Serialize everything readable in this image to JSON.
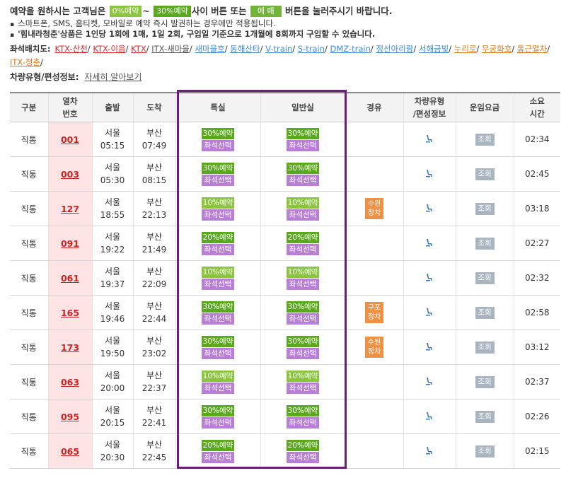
{
  "notice": {
    "line1_a": "예약을 원하시는 고객님은",
    "pill_0": "0%예약",
    "tilde": "~",
    "pill_30": "30%예약",
    "line1_b": "사이 버튼 또는",
    "pill_buy": "예 매",
    "line1_c": "버튼을 눌러주시기 바랍니다.",
    "bullet1": "스마트폰, SMS, 홈티켓, 모바일로 예약 즉시 발권하는 경우에만 적용됩니다.",
    "bullet2": "'힘내라청춘'상품은 1인당 1회에 1매, 1일 2회, 구입일 기준으로 1개월에 8회까지 구입할 수 있습니다."
  },
  "seatmap": {
    "label": "좌석배치도:",
    "links": [
      {
        "text": "KTX-산천",
        "color": "#d9262f"
      },
      {
        "text": "KTX-이음",
        "color": "#d9262f"
      },
      {
        "text": "KTX",
        "color": "#d9262f"
      },
      {
        "text": "ITX-새마을",
        "color": "#555555"
      },
      {
        "text": "새마을호",
        "color": "#3d8bd9"
      },
      {
        "text": "동해산타",
        "color": "#3d8bd9"
      },
      {
        "text": "V-train",
        "color": "#3d8bd9"
      },
      {
        "text": "S-train",
        "color": "#3d8bd9"
      },
      {
        "text": "DMZ-train",
        "color": "#3d8bd9"
      },
      {
        "text": "정선아리랑",
        "color": "#3d8bd9"
      },
      {
        "text": "서해금빛",
        "color": "#3d8bd9"
      },
      {
        "text": "누리로",
        "color": "#e07b1a"
      },
      {
        "text": "무궁화호",
        "color": "#e07b1a"
      },
      {
        "text": "통근열차",
        "color": "#e07b1a"
      },
      {
        "text": "ITX-청춘",
        "color": "#e07b1a"
      }
    ]
  },
  "cartype": {
    "label": "차량유형/편성정보:",
    "link": "자세히 알아보기"
  },
  "headers": {
    "type": "구분",
    "trainno_a": "열차",
    "trainno_b": "번호",
    "dep": "출발",
    "arr": "도착",
    "special": "특실",
    "general": "일반실",
    "via": "경유",
    "car_a": "차량유형",
    "car_b": "/편성정보",
    "fare": "운임요금",
    "dur_a": "소요",
    "dur_b": "시간"
  },
  "rows": [
    {
      "type": "직통",
      "no": "001",
      "dep": "서울",
      "dep_time": "05:15",
      "arr": "부산",
      "arr_time": "07:49",
      "special": "30%예약",
      "general": "30%예약",
      "seat": "좌석선택",
      "via": "",
      "fare": "조회",
      "dur": "02:34"
    },
    {
      "type": "직통",
      "no": "003",
      "dep": "서울",
      "dep_time": "05:30",
      "arr": "부산",
      "arr_time": "08:15",
      "special": "30%예약",
      "general": "30%예약",
      "seat": "좌석선택",
      "via": "",
      "fare": "조회",
      "dur": "02:45"
    },
    {
      "type": "직통",
      "no": "127",
      "dep": "서울",
      "dep_time": "18:55",
      "arr": "부산",
      "arr_time": "22:13",
      "special": "10%예약",
      "general": "10%예약",
      "seat": "좌석선택",
      "via": "수원\n정차",
      "fare": "조회",
      "dur": "03:18"
    },
    {
      "type": "직통",
      "no": "091",
      "dep": "서울",
      "dep_time": "19:22",
      "arr": "부산",
      "arr_time": "21:49",
      "special": "20%예약",
      "general": "20%예약",
      "seat": "좌석선택",
      "via": "",
      "fare": "조회",
      "dur": "02:27"
    },
    {
      "type": "직통",
      "no": "061",
      "dep": "서울",
      "dep_time": "19:37",
      "arr": "부산",
      "arr_time": "22:09",
      "special": "10%예약",
      "general": "10%예약",
      "seat": "좌석선택",
      "via": "",
      "fare": "조회",
      "dur": "02:32"
    },
    {
      "type": "직통",
      "no": "165",
      "dep": "서울",
      "dep_time": "19:46",
      "arr": "부산",
      "arr_time": "22:44",
      "special": "30%예약",
      "general": "30%예약",
      "seat": "좌석선택",
      "via": "구포\n정차",
      "fare": "조회",
      "dur": "02:58"
    },
    {
      "type": "직통",
      "no": "173",
      "dep": "서울",
      "dep_time": "19:50",
      "arr": "부산",
      "arr_time": "23:02",
      "special": "30%예약",
      "general": "30%예약",
      "seat": "좌석선택",
      "via": "수원\n정차",
      "fare": "조회",
      "dur": "03:12"
    },
    {
      "type": "직통",
      "no": "063",
      "dep": "서울",
      "dep_time": "20:00",
      "arr": "부산",
      "arr_time": "22:37",
      "special": "10%예약",
      "general": "10%예약",
      "seat": "좌석선택",
      "via": "",
      "fare": "조회",
      "dur": "02:37"
    },
    {
      "type": "직통",
      "no": "095",
      "dep": "서울",
      "dep_time": "20:15",
      "arr": "부산",
      "arr_time": "22:41",
      "special": "30%예약",
      "general": "30%예약",
      "seat": "좌석선택",
      "via": "",
      "fare": "조회",
      "dur": "02:26"
    },
    {
      "type": "직통",
      "no": "065",
      "dep": "서울",
      "dep_time": "20:30",
      "arr": "부산",
      "arr_time": "22:45",
      "special": "20%예약",
      "general": "20%예약",
      "seat": "좌석선택",
      "via": "",
      "fare": "조회",
      "dur": "02:15"
    }
  ],
  "colors": {
    "highlight": "#6f1b7a",
    "seat_button": "#b97fd6",
    "discount_button": "#5aa91d",
    "stop_badge": "#ef9144",
    "fare_button": "#a8b4c0",
    "train_no_bg": "#fde3e4"
  }
}
